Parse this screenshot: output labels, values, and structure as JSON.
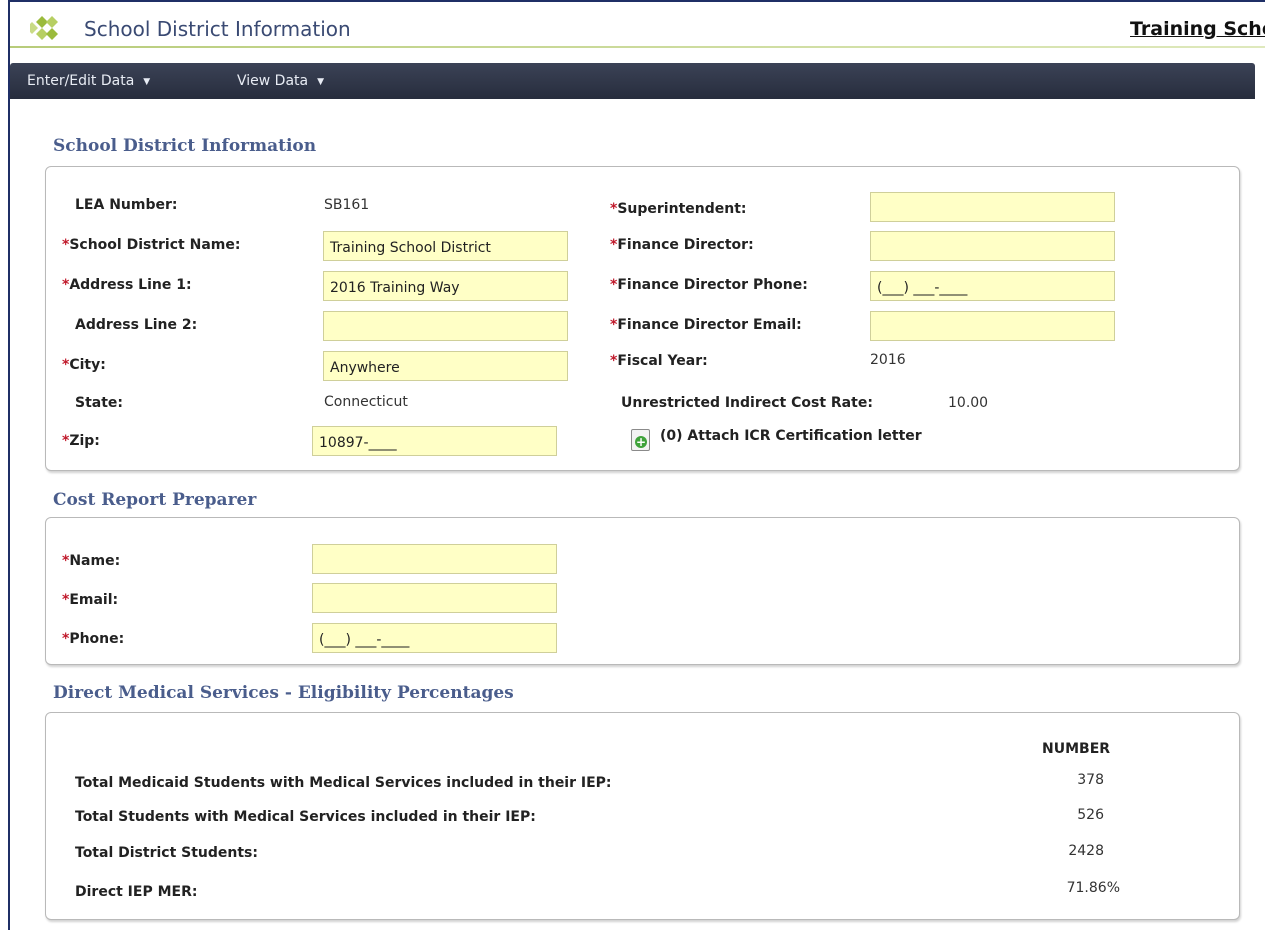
{
  "app": {
    "title": "School District Information",
    "header_right": "Training School District",
    "colors": {
      "navbar": "#2f3546",
      "heading": "#4a5d8c",
      "required": "#c0192b",
      "input_bg": "#ffffc6"
    }
  },
  "nav": {
    "enter_edit": "Enter/Edit Data",
    "view": "View Data",
    "caret": "▼"
  },
  "district": {
    "heading": "School District Information",
    "required_mark": "*",
    "lea_label": "LEA Number:",
    "lea_value": "SB161",
    "name_label": "School District Name:",
    "name_value": "Training School District",
    "addr1_label": "Address Line 1:",
    "addr1_value": "2016 Training Way",
    "addr2_label": "Address Line 2:",
    "addr2_value": "",
    "city_label": "City:",
    "city_value": "Anywhere",
    "state_label": "State:",
    "state_value": "Connecticut",
    "zip_label": "Zip:",
    "zip_value": "10897-____",
    "super_label": "Superintendent:",
    "super_value": "",
    "fin_dir_label": "Finance Director:",
    "fin_dir_value": "",
    "fin_phone_label": "Finance Director Phone:",
    "fin_phone_value": "(___) ___-____",
    "fin_email_label": "Finance Director Email:",
    "fin_email_value": "",
    "fiscal_label": "Fiscal Year:",
    "fiscal_value": "2016",
    "icr_label": "Unrestricted Indirect Cost Rate:",
    "icr_value": "10.00",
    "attach_label": "(0) Attach ICR Certification letter",
    "attach_icon": "add-document-icon"
  },
  "preparer": {
    "heading": "Cost Report Preparer",
    "name_label": "Name:",
    "name_value": "",
    "email_label": "Email:",
    "email_value": "",
    "phone_label": "Phone:",
    "phone_value": "(___) ___-____"
  },
  "eligibility": {
    "heading": "Direct Medical Services - Eligibility Percentages",
    "col_header": "NUMBER",
    "rows": [
      {
        "label": "Total Medicaid Students with Medical Services included in their IEP:",
        "value": "378"
      },
      {
        "label": "Total Students with Medical Services included in their IEP:",
        "value": "526"
      },
      {
        "label": "Total District Students:",
        "value": "2428"
      },
      {
        "label": "Direct IEP MER:",
        "value": "71.86%"
      }
    ]
  }
}
